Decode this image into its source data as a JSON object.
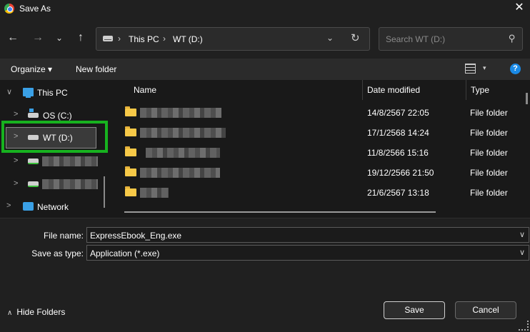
{
  "window": {
    "title": "Save As",
    "close_label": "✕"
  },
  "nav": {
    "back": "←",
    "forward": "→",
    "recent": "⌄",
    "up": "↑",
    "breadcrumb": [
      {
        "label": "This PC"
      },
      {
        "label": "WT (D:)"
      }
    ],
    "separator": "›",
    "dropdown": "⌄",
    "refresh": "↻",
    "search_placeholder": "Search WT (D:)",
    "search_icon": "⚲"
  },
  "toolbar": {
    "organize": "Organize ▾",
    "new_folder": "New folder",
    "view_caret": "▾",
    "help": "?"
  },
  "sidebar": {
    "items": [
      {
        "label": "This PC",
        "chevron": "∨",
        "icon": "pc-icon"
      },
      {
        "label": "OS (C:)",
        "chevron": ">",
        "icon": "windows-drive-icon"
      },
      {
        "label": "WT (D:)",
        "chevron": ">",
        "icon": "drive-icon"
      },
      {
        "label": "",
        "chevron": ">",
        "icon": "usb-drive-icon"
      },
      {
        "label": "",
        "chevron": ">",
        "icon": "usb-drive-icon"
      },
      {
        "label": "Network",
        "chevron": ">",
        "icon": "network-icon"
      }
    ]
  },
  "files": {
    "columns": {
      "name": "Name",
      "date": "Date modified",
      "type": "Type"
    },
    "rows": [
      {
        "date": "14/8/2567 22:05",
        "type": "File folder"
      },
      {
        "date": "17/1/2568 14:24",
        "type": "File folder"
      },
      {
        "date": "11/8/2566 15:16",
        "type": "File folder"
      },
      {
        "date": "19/12/2566 21:50",
        "type": "File folder"
      },
      {
        "date": "21/6/2567 13:18",
        "type": "File folder"
      }
    ]
  },
  "form": {
    "file_name_label": "File name:",
    "file_name_value": "ExpressEbook_Eng.exe",
    "save_type_label": "Save as type:",
    "save_type_value": "Application (*.exe)",
    "dropdown": "∨"
  },
  "footer": {
    "hide_folders": "Hide Folders",
    "hide_caret": "∧",
    "save": "Save",
    "cancel": "Cancel"
  },
  "colors": {
    "highlight": "#17b21f",
    "accent": "#1a8ae6",
    "folder": "#f7c948"
  }
}
